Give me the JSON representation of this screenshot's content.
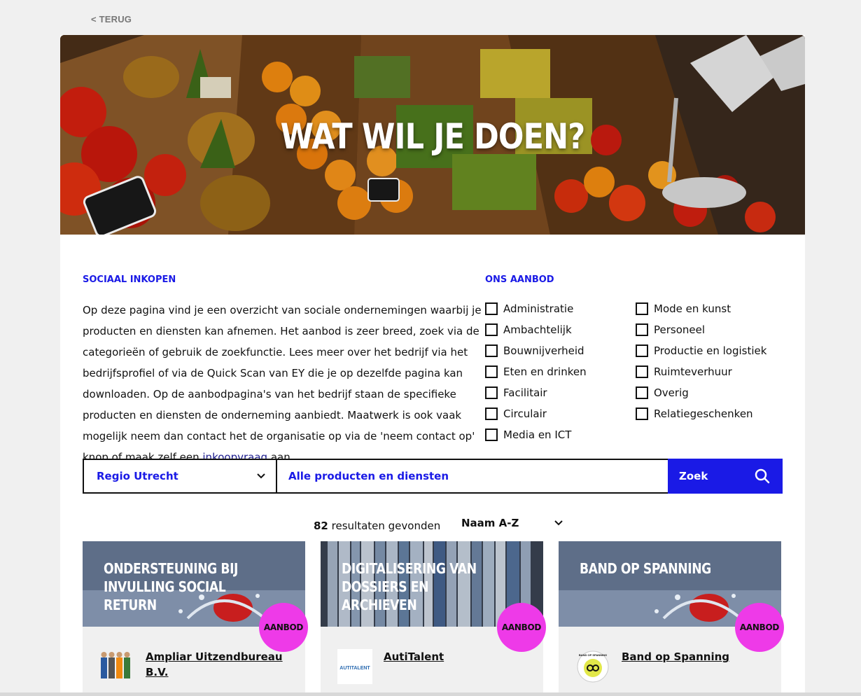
{
  "nav": {
    "back_label": "< TERUG"
  },
  "hero": {
    "title": "WAT WIL JE DOEN?"
  },
  "intro": {
    "heading": "SOCIAAL INKOPEN",
    "text_before_link": "Op deze pagina vind je een overzicht van sociale ondernemingen waarbij je producten en diensten kan afnemen. Het aanbod is zeer breed, zoek via de categorieën of gebruik de zoekfunctie. Lees meer over het bedrijf via het bedrijfsprofiel of via de Quick Scan van EY die je op dezelfde pagina kan downloaden. Op de aanbodpagina's van het bedrijf staan de specifieke producten en diensten de onderneming aanbiedt. Maatwerk is ook vaak mogelijk neem dan contact het de organisatie op via de 'neem contact op' knop of maak zelf een ",
    "link_text": "inkoopvraag",
    "text_after_link": " aan."
  },
  "offer": {
    "heading": "ONS AANBOD",
    "column1": [
      "Administratie",
      "Ambachtelijk",
      "Bouwnijverheid",
      "Eten en drinken",
      "Facilitair",
      "Circulair",
      "Media en ICT"
    ],
    "column2": [
      "Mode en kunst",
      "Personeel",
      "Productie en logistiek",
      "Ruimteverhuur",
      "Overig",
      "Relatiegeschenken"
    ]
  },
  "search": {
    "region": "Regio Utrecht",
    "products": "Alle producten en diensten",
    "button": "Zoek"
  },
  "results": {
    "count": "82",
    "label": " resultaten gevonden",
    "sort": "Naam A-Z"
  },
  "cards": [
    {
      "title": "ONDERSTEUNING BIJ INVULLING SOCIAL RETURN",
      "badge": "AANBOD",
      "company": "Ampliar Uitzendbureau B.V."
    },
    {
      "title": "DIGITALISERING VAN DOSSIERS EN ARCHIEVEN",
      "badge": "AANBOD",
      "company": "AutiTalent"
    },
    {
      "title": "BAND OP SPANNING",
      "badge": "AANBOD",
      "company": "Band op Spanning"
    }
  ],
  "logos": {
    "autitalent_text": "AUTITALENT",
    "band_text": "BAND OP SPANNING"
  },
  "colors": {
    "accent": "#1a1ae6",
    "badge": "#ee3ae8",
    "link": "#1a1a8c"
  }
}
